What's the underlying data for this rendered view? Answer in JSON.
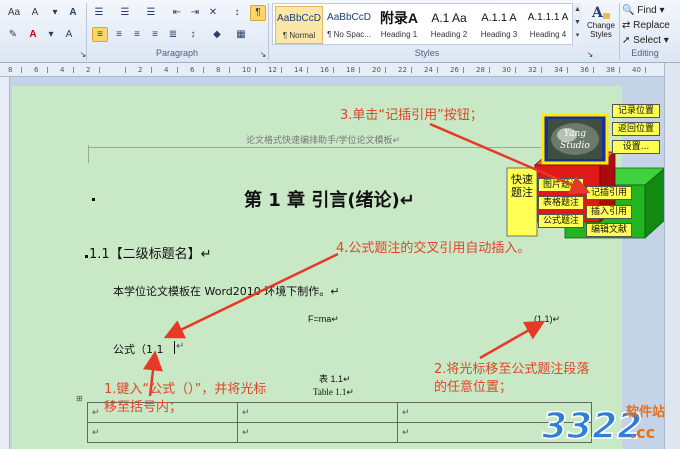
{
  "ribbon": {
    "paragraph_label": "Paragraph",
    "styles_label": "Styles",
    "editing_label": "Editing",
    "font_size_label": "Aa",
    "find_label": "Find",
    "replace_label": "Replace",
    "select_label": "Select",
    "change_styles_label": "Change Styles",
    "change_styles_line1": "Change",
    "change_styles_line2": "Styles",
    "style_tiles": [
      {
        "preview": "AaBbCcD",
        "name": "¶ Normal"
      },
      {
        "preview": "AaBbCcD",
        "name": "¶ No Spac..."
      },
      {
        "preview": "附录A",
        "name": "Heading 1"
      },
      {
        "preview": "A.1 Aa",
        "name": "Heading 2"
      },
      {
        "preview": "A.1.1 A",
        "name": "Heading 3"
      },
      {
        "preview": "A.1.1.1 A",
        "name": "Heading 4"
      }
    ]
  },
  "ruler": {
    "ticks": [
      "8",
      "6",
      "4",
      "2",
      "",
      "2",
      "4",
      "6",
      "8",
      "10",
      "12",
      "14",
      "16",
      "18",
      "20",
      "22",
      "24",
      "26",
      "28",
      "30",
      "32",
      "34",
      "36",
      "38",
      "40"
    ]
  },
  "document": {
    "header": "论文格式快速编排助手/学位论文模板↵",
    "chapter_title": "第 1 章  引言(绪论)↵",
    "section_title": "1.1【二级标题名】↵",
    "body_text": "本学位论文模板在 Word2010 环境下制作。↵",
    "equation": "F=ma↵",
    "equation_number": "(1.1)↵",
    "formula_ref": "公式（1.1",
    "table_caption_cn": "表 1.1↵",
    "table_caption_en": "Table 1.1↵",
    "table_cell_mark": "↵",
    "para_mark": "↵"
  },
  "annotations": {
    "step1": "1.键入“公式（）”，并将光标移至括号内；",
    "step1_line1": "1.键入“公式（）”，并将光标",
    "step1_line2": "移至括号内；",
    "step2": "2.将光标移至公式题注段落的任意位置；",
    "step2_line1": "2.将光标移至公式题注段落",
    "step2_line2": "的任意位置；",
    "step3": "3.单击“记插引用”按钮；",
    "step4": "4.公式题注的交叉引用自动插入。",
    "colors": {
      "annotation": "#e0452b",
      "toolbar_button": "#ffff54",
      "page": "#c9e8c5"
    }
  },
  "toolbar3d": {
    "record_position": "记录位置",
    "return_position": "返回位置",
    "settings": "设置...",
    "quick_caption": "快速题注",
    "figure_caption": "图片题注",
    "table_caption": "表格题注",
    "formula_caption": "公式题注",
    "insert_reference_mark": "记插引用",
    "insert_reference": "插入引用",
    "edit_literature": "编辑文献",
    "logo_text": "Yang Studio"
  },
  "watermark": {
    "logo_number": "3322",
    "site_text": "软件站",
    "domain": ".cc"
  }
}
